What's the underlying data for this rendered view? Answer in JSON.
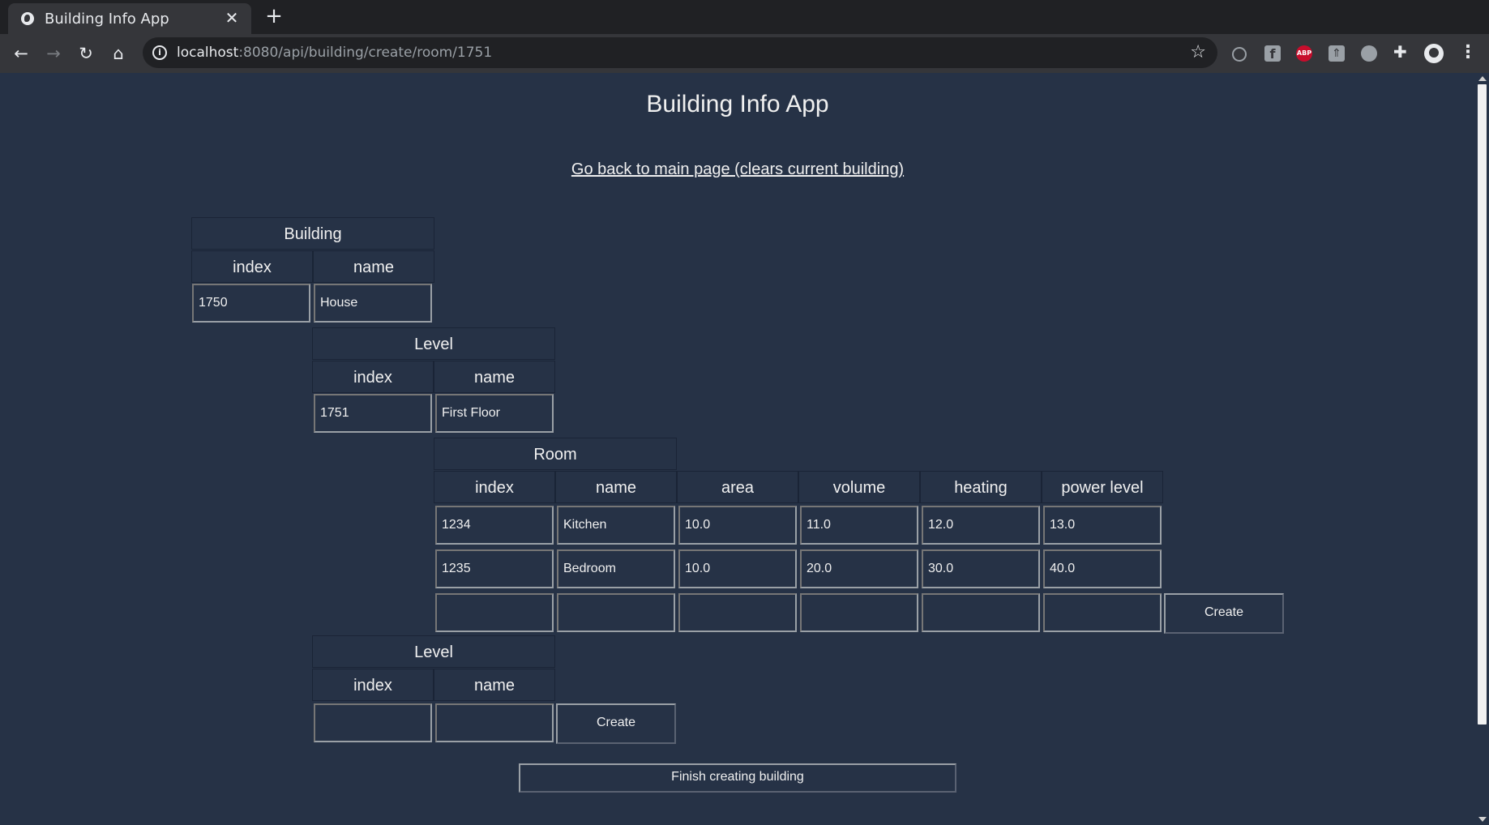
{
  "browser": {
    "tab_title": "Building Info App",
    "url_host": "localhost",
    "url_path": ":8080/api/building/create/room/1751"
  },
  "page": {
    "title": "Building Info App",
    "back_link": "Go back to main page (clears current building)",
    "finish_button": "Finish creating building"
  },
  "building": {
    "header": "Building",
    "columns": [
      "index",
      "name"
    ],
    "row": {
      "index": "1750",
      "name": "House"
    }
  },
  "level": {
    "header": "Level",
    "columns": [
      "index",
      "name"
    ],
    "row": {
      "index": "1751",
      "name": "First Floor"
    }
  },
  "room": {
    "header": "Room",
    "columns": [
      "index",
      "name",
      "area",
      "volume",
      "heating",
      "power level"
    ],
    "rows": [
      [
        "1234",
        "Kitchen",
        "10.0",
        "11.0",
        "12.0",
        "13.0"
      ],
      [
        "1235",
        "Bedroom",
        "10.0",
        "20.0",
        "30.0",
        "40.0"
      ]
    ],
    "new_row": [
      "",
      "",
      "",
      "",
      "",
      ""
    ],
    "create_button": "Create"
  },
  "new_level": {
    "header": "Level",
    "columns": [
      "index",
      "name"
    ],
    "new_row": [
      "",
      ""
    ],
    "create_button": "Create"
  }
}
